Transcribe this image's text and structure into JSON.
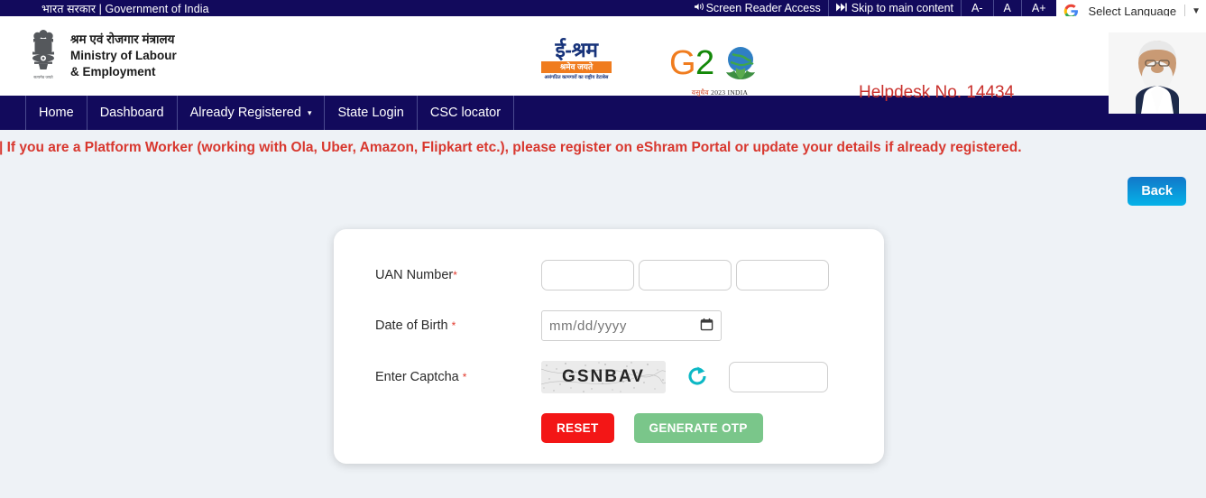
{
  "topbar": {
    "gov_label": "भारत सरकार | Government of India",
    "screen_reader": "Screen Reader Access",
    "skip_to_main": "Skip to main content",
    "font_decrease": "A-",
    "font_normal": "A",
    "font_increase": "A+",
    "translate_label": "Select Language",
    "translate_caret": "▼",
    "bg_color": "#120a5c"
  },
  "header": {
    "ministry_hindi": "श्रम एवं रोजगार मंत्रालय",
    "ministry_en_line1": "Ministry of Labour",
    "ministry_en_line2": "& Employment",
    "eshram_title": "ई-श्रम",
    "eshram_motto": "श्रमेव जयते",
    "eshram_tagline": "असंगठित कामगारों का राष्ट्रीय डेटाबेस",
    "g20_text": "G20",
    "g20_sub_hindi": "वसुधैव",
    "g20_sub_year": "2023 INDIA",
    "helpdesk": "Helpdesk No. 14434",
    "helpdesk_color": "#c9302c"
  },
  "nav": {
    "items": [
      {
        "label": "Home",
        "has_caret": false
      },
      {
        "label": "Dashboard",
        "has_caret": false
      },
      {
        "label": "Already Registered",
        "has_caret": true
      },
      {
        "label": "State Login",
        "has_caret": false
      },
      {
        "label": "CSC locator",
        "has_caret": false
      }
    ],
    "caret": "▾"
  },
  "marquee": {
    "text": "डेट करें | If you are a Platform Worker (working with Ola, Uber, Amazon, Flipkart etc.), please register on eShram Portal or update your details if already registered.",
    "color": "#d8382f"
  },
  "content": {
    "back_label": "Back"
  },
  "form": {
    "uan_label": "UAN Number",
    "uan_required": "*",
    "uan_values": [
      "",
      "",
      ""
    ],
    "uan_placeholders": [
      "",
      "",
      ""
    ],
    "dob_label": "Date of Birth",
    "dob_required": "*",
    "dob_placeholder": "mm/dd/yyyy",
    "dob_value": "",
    "captcha_label": "Enter Captcha",
    "captcha_required": "*",
    "captcha_code": "GSNBAV",
    "captcha_input_value": "",
    "captcha_input_placeholder": "",
    "refresh_icon": "refresh-icon",
    "reset_label": "RESET",
    "generate_otp_label": "GENERATE OTP",
    "reset_color": "#f31616",
    "otp_color": "#7ac68a"
  }
}
